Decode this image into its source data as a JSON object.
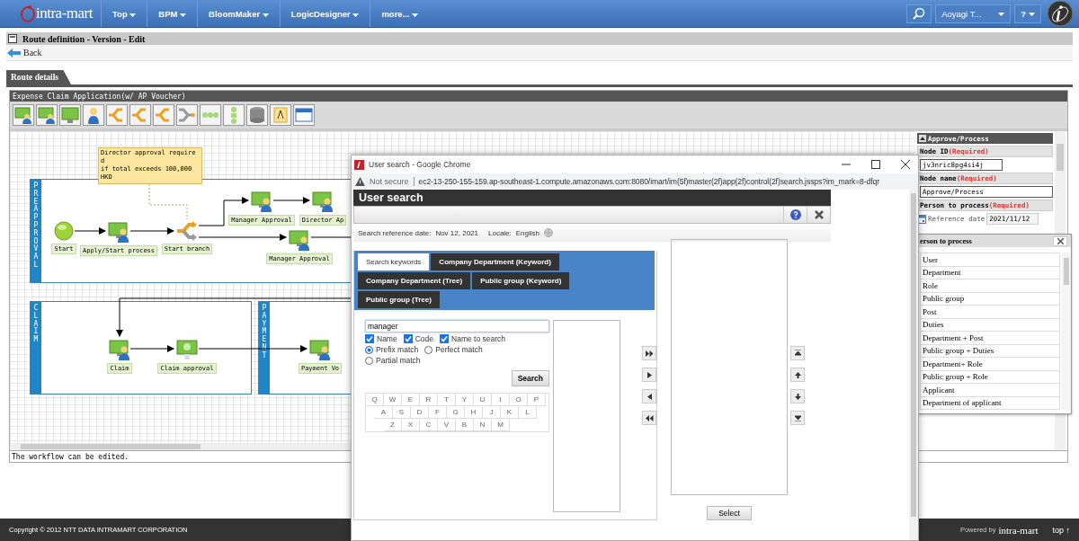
{
  "top_nav": {
    "logo": "intra-mart",
    "menus": [
      "Top",
      "BPM",
      "BloomMaker",
      "LogicDesigner",
      "more..."
    ],
    "user": "Aoyagi T...",
    "help": "?"
  },
  "page": {
    "title": "Route definition - Version - Edit",
    "back": "Back",
    "tabs": [
      {
        "label": "Route details",
        "selected": true
      }
    ]
  },
  "editor": {
    "title": "Expense Claim Application(w/ AP Voucher)",
    "note": "Director approval require\nd\nif total exceeds 100,000\nHKD",
    "lanes": [
      "PREAPPROVAL",
      "CLAIM",
      "PAYMENT"
    ],
    "nodes": [
      {
        "kind": "start",
        "label": "Start"
      },
      {
        "kind": "task",
        "label": "Apply/Start process"
      },
      {
        "kind": "branch",
        "label": "Start branch"
      },
      {
        "kind": "task",
        "label": "Manager Approval"
      },
      {
        "kind": "task",
        "label": "Director Ap"
      },
      {
        "kind": "task",
        "label": "Manager Approval"
      },
      {
        "kind": "task",
        "label": "Claim"
      },
      {
        "kind": "approval",
        "label": "Claim approval"
      },
      {
        "kind": "task",
        "label": "Payment Vo"
      }
    ],
    "status": "The workflow can be edited."
  },
  "properties": {
    "section": "Approve/Process",
    "fields": [
      {
        "label": "Node ID",
        "required": "(Required)",
        "value": "jv3nric8pg4si4j"
      },
      {
        "label": "Node name",
        "required": "(Required)",
        "value": "Approve/Process"
      },
      {
        "label": "Person to process",
        "required": "(Required)"
      }
    ],
    "reference_label": "Reference date",
    "reference_date": "2021/11/12"
  },
  "dropdown": {
    "title": "erson to process",
    "items": [
      "User",
      "Department",
      "Role",
      "Public group",
      "Post",
      "Duties",
      "Department + Post",
      "Public group + Duties",
      "Department+ Role",
      "Public group + Role",
      "Applicant",
      "Department of applicant"
    ]
  },
  "popup": {
    "window_title": "User search - Google Chrome",
    "security": "Not secure",
    "url": "ec2-13-250-155-159.ap-southeast-1.compute.amazonaws.com:8080/imart/im(5f)master(2f)app(2f)control(2f)search.jssps?im_mark=8-dfqr",
    "title": "User search",
    "date_label": "Search reference date:",
    "date": "Nov 12, 2021",
    "locale_label": "Locale:",
    "locale": "English",
    "tabs": [
      {
        "label": "Search keywords",
        "selected": true
      },
      {
        "label": "Company Department (Keyword)",
        "selected": false
      },
      {
        "label": "Company Department (Tree)",
        "selected": false
      },
      {
        "label": "Public group (Keyword)",
        "selected": false
      },
      {
        "label": "Public group (Tree)",
        "selected": false
      }
    ],
    "keyword": "manager",
    "checkboxes": [
      {
        "label": "Name",
        "checked": true
      },
      {
        "label": "Code",
        "checked": true
      },
      {
        "label": "Name to search",
        "checked": true
      }
    ],
    "match": [
      {
        "label": "Prefix match",
        "selected": true
      },
      {
        "label": "Perfect match",
        "selected": false
      },
      {
        "label": "Partial match",
        "selected": false
      }
    ],
    "search_button": "Search",
    "keys": [
      [
        "Q",
        "W",
        "E",
        "R",
        "T",
        "Y",
        "U",
        "I",
        "O",
        "P"
      ],
      [
        "A",
        "S",
        "D",
        "F",
        "G",
        "H",
        "J",
        "K",
        "L"
      ],
      [
        "Z",
        "X",
        "C",
        "V",
        "B",
        "N",
        "M"
      ]
    ],
    "select_button": "Select"
  },
  "footer": {
    "copyright": "Copyright © 2012 NTT DATA INTRAMART CORPORATION",
    "powered": "Powered by",
    "logo": "intra-mart",
    "top": "top ↑"
  }
}
